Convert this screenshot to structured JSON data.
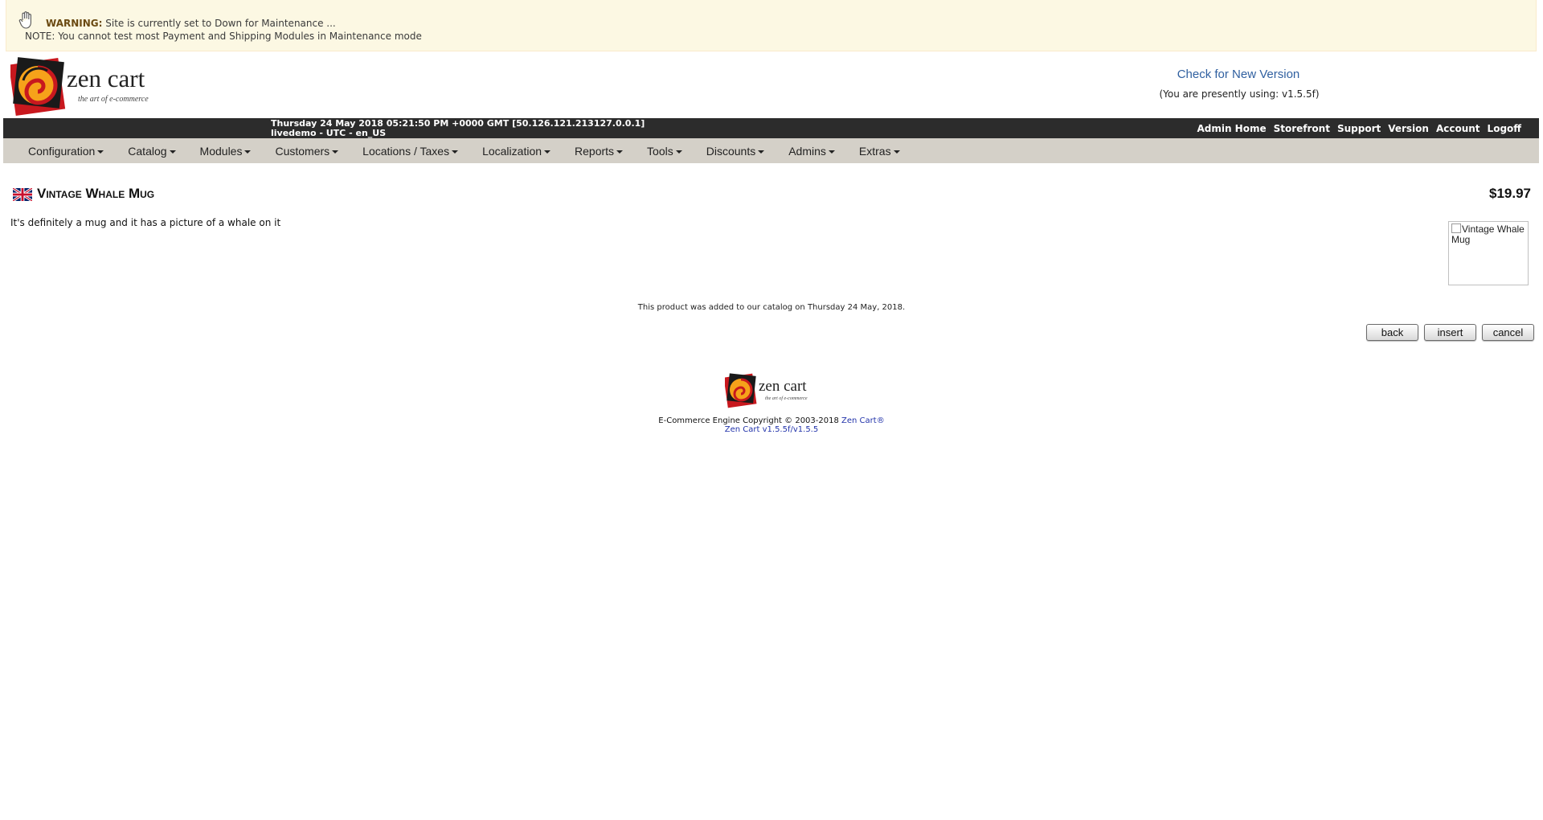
{
  "warning": {
    "label": "WARNING:",
    "message": "Site is currently set to Down for Maintenance ...",
    "note": "NOTE: You cannot test most Payment and Shipping Modules in Maintenance mode"
  },
  "header": {
    "logo_text": "zen cart",
    "logo_tagline": "the art of e-commerce",
    "check_version": "Check for New Version",
    "using_version": "(You are presently using: v1.5.5f)"
  },
  "statusbar": {
    "datetime": "Thursday 24 May 2018 05:21:50 PM +0000 GMT [50.126.121.213127.0.0.1]",
    "server": "livedemo - UTC - en_US",
    "links": [
      "Admin Home",
      "Storefront",
      "Support",
      "Version",
      "Account",
      "Logoff"
    ]
  },
  "menu": [
    "Configuration",
    "Catalog",
    "Modules",
    "Customers",
    "Locations / Taxes",
    "Localization",
    "Reports",
    "Tools",
    "Discounts",
    "Admins",
    "Extras"
  ],
  "product": {
    "name": "Vintage Whale Mug",
    "price": "$19.97",
    "description": "It's definitely a mug and it has a picture of a whale on it",
    "image_alt": "Vintage Whale Mug",
    "added_text": "This product was added to our catalog on Thursday 24 May, 2018."
  },
  "buttons": {
    "back": "back",
    "insert": "insert",
    "cancel": "cancel"
  },
  "footer": {
    "copyright": "E-Commerce Engine Copyright © 2003-2018",
    "brand": "Zen Cart®",
    "version": "Zen Cart v1.5.5f/v1.5.5"
  }
}
